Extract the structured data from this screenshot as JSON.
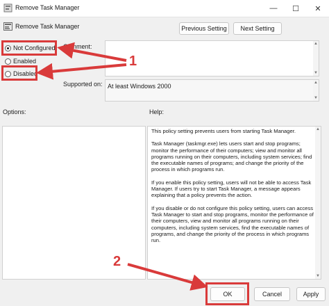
{
  "window": {
    "title": "Remove Task Manager",
    "minimize_glyph": "—",
    "maximize_glyph": "☐",
    "close_glyph": "✕"
  },
  "header": {
    "title": "Remove Task Manager",
    "prev_label": "Previous Setting",
    "next_label": "Next Setting"
  },
  "state": {
    "options": [
      {
        "label": "Not Configured",
        "checked": true
      },
      {
        "label": "Enabled",
        "checked": false
      },
      {
        "label": "Disabled",
        "checked": false
      }
    ]
  },
  "labels": {
    "comment": "Comment:",
    "supported_on": "Supported on:",
    "options": "Options:",
    "help": "Help:"
  },
  "supported_value": "At least Windows 2000",
  "help_paragraphs": [
    "This policy setting prevents users from starting Task Manager.",
    "Task Manager (taskmgr.exe) lets users start and stop programs; monitor the performance of their computers; view and monitor all programs running on their computers, including system services; find the executable names of programs; and change the priority of the process in which programs run.",
    "If you enable this policy setting, users will not be able to access Task Manager. If users try to start Task Manager, a message appears explaining that a policy prevents the action.",
    "If you disable or do not configure this policy setting, users can access Task Manager to  start and stop programs, monitor the performance of their computers, view and monitor all programs running on their computers, including system services, find the executable names of programs, and change the priority of the process in which programs run."
  ],
  "footer": {
    "ok_label": "OK",
    "cancel_label": "Cancel",
    "apply_label": "Apply"
  },
  "annotations": {
    "callout_1": "1",
    "callout_2": "2",
    "color": "#d93a3a"
  },
  "icons": {
    "app": "policy-editor-icon",
    "header": "policy-setting-icon"
  }
}
